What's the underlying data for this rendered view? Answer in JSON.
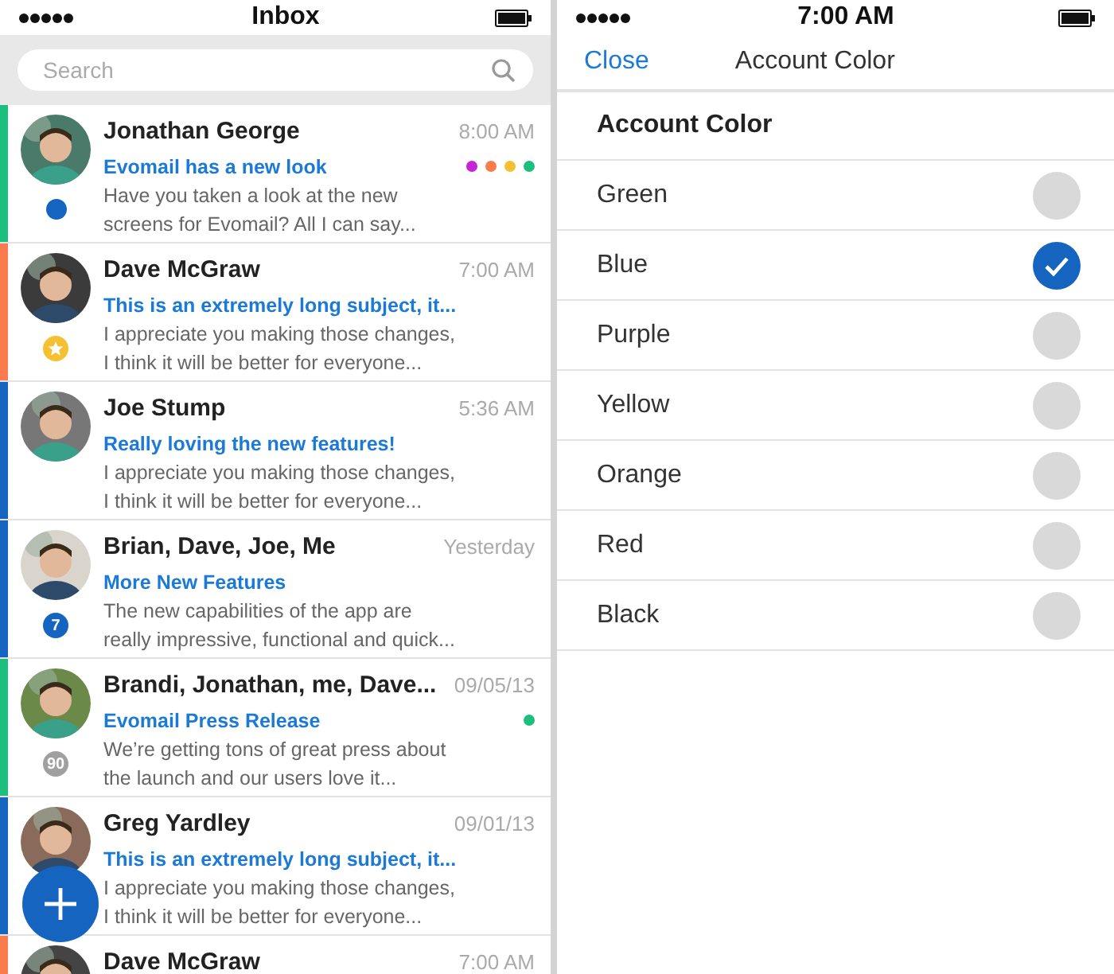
{
  "inbox": {
    "status_bar": {
      "title": "Inbox"
    },
    "search": {
      "placeholder": "Search"
    },
    "messages": [
      {
        "color": "#1dbf7f",
        "sender": "Jonathan George",
        "time": "8:00 AM",
        "subject": "Evomail has a new look",
        "preview": [
          "Have you taken a look at the new",
          "screens for Evomail? All I can say..."
        ],
        "badge": {
          "kind": "dot",
          "color": "#1565c0"
        },
        "tags": [
          {
            "color": "#c724d6"
          },
          {
            "color": "#f97b4e"
          },
          {
            "color": "#f6c131"
          },
          {
            "color": "#1dbf7f"
          }
        ]
      },
      {
        "color": "#f97b4e",
        "sender": "Dave McGraw",
        "time": "7:00 AM",
        "subject": "This is an extremely long subject, it...",
        "preview": [
          "I appreciate you making those changes,",
          "I think it will be better for everyone..."
        ],
        "badge": {
          "kind": "star",
          "color": "#f6c131"
        }
      },
      {
        "color": "#1565c0",
        "sender": "Joe Stump",
        "time": "5:36 AM",
        "subject": "Really loving the new features!",
        "preview": [
          "I appreciate you making those changes,",
          "I think it will be better for everyone..."
        ]
      },
      {
        "color": "#1565c0",
        "sender": "Brian, Dave, Joe, Me",
        "time": "Yesterday",
        "subject": "More New Features",
        "preview": [
          "The new capabilities of the app are",
          "really impressive, functional and quick..."
        ],
        "badge": {
          "kind": "count",
          "text": "7",
          "color": "#1565c0"
        }
      },
      {
        "color": "#1dbf7f",
        "sender": "Brandi, Jonathan, me, Dave...",
        "time": "09/05/13",
        "subject": "Evomail Press Release",
        "preview": [
          "We’re getting tons of great press about",
          "the launch and our users love it..."
        ],
        "badge": {
          "kind": "count",
          "text": "90",
          "color": "#a0a0a0"
        },
        "tags": [
          {
            "color": "#1dbf7f"
          }
        ]
      },
      {
        "color": "#1565c0",
        "sender": "Greg Yardley",
        "time": "09/01/13",
        "subject": "This is an extremely long subject, it...",
        "preview": [
          "I appreciate you making those changes,",
          "I think it will be better for everyone..."
        ]
      },
      {
        "color": "#f97b4e",
        "sender": "Dave McGraw",
        "time": "7:00 AM"
      }
    ]
  },
  "account_color": {
    "status_bar": {
      "time": "7:00 AM"
    },
    "nav": {
      "back": "Close",
      "title": "Account Color"
    },
    "section": "Account Color",
    "options": [
      {
        "label": "Green",
        "selected": false
      },
      {
        "label": "Blue",
        "selected": true
      },
      {
        "label": "Purple",
        "selected": false
      },
      {
        "label": "Yellow",
        "selected": false
      },
      {
        "label": "Orange",
        "selected": false
      },
      {
        "label": "Red",
        "selected": false
      },
      {
        "label": "Black",
        "selected": false
      }
    ]
  }
}
